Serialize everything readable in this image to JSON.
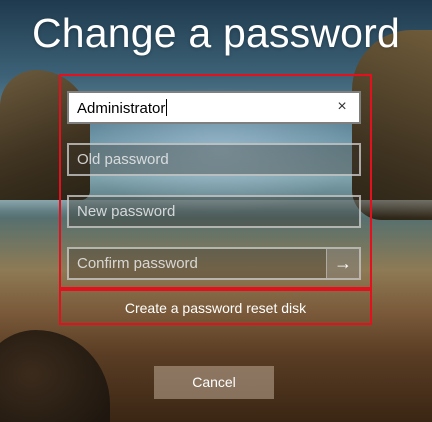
{
  "title": "Change a password",
  "fields": {
    "username": {
      "value": "Administrator",
      "clear_icon": "×"
    },
    "old_password": {
      "placeholder": "Old password"
    },
    "new_password": {
      "placeholder": "New password"
    },
    "confirm_password": {
      "placeholder": "Confirm password",
      "submit_icon": "→"
    }
  },
  "reset_link": "Create a password reset disk",
  "cancel_label": "Cancel",
  "colors": {
    "highlight": "#e3101e",
    "text": "#ffffff"
  }
}
